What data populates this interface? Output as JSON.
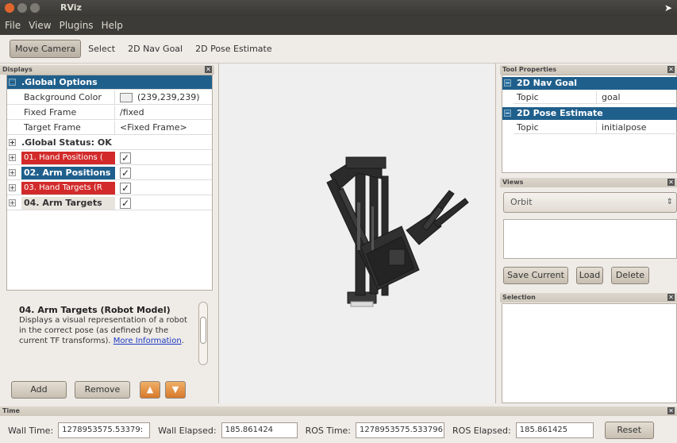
{
  "window": {
    "title": "RViz"
  },
  "menu": [
    "File",
    "View",
    "Plugins",
    "Help"
  ],
  "toolbar": {
    "tools": [
      "Move Camera",
      "Select",
      "2D Nav Goal",
      "2D Pose Estimate"
    ],
    "active": "Move Camera"
  },
  "displays": {
    "title": "Displays",
    "global_options": {
      "label": ".Global Options",
      "props": [
        {
          "name": "Background Color",
          "value": "(239,239,239)",
          "swatch": "#efefef"
        },
        {
          "name": "Fixed Frame",
          "value": "/fixed"
        },
        {
          "name": "Target Frame",
          "value": "<Fixed Frame>"
        }
      ]
    },
    "global_status": ".Global Status: OK",
    "items": [
      {
        "label": "01. Hand Positions (",
        "status": "error",
        "checked": "✓"
      },
      {
        "label": "02. Arm Positions",
        "status": "ok",
        "checked": "✓"
      },
      {
        "label": "03. Hand Targets (R",
        "status": "error",
        "checked": "✓"
      },
      {
        "label": "04. Arm Targets",
        "status": "warn",
        "checked": "✓"
      }
    ]
  },
  "description": {
    "title": "04. Arm Targets (Robot Model)",
    "text": "Displays a visual representation of a robot in the correct pose (as defined by the current TF transforms).",
    "link": "More Information",
    "link_tail": "."
  },
  "display_buttons": {
    "add": "Add",
    "remove": "Remove"
  },
  "tool_properties": {
    "title": "Tool Properties",
    "groups": [
      {
        "label": "2D Nav Goal",
        "key": "Topic",
        "value": "goal"
      },
      {
        "label": "2D Pose Estimate",
        "key": "Topic",
        "value": "initialpose"
      }
    ]
  },
  "views": {
    "title": "Views",
    "selected": "Orbit",
    "save": "Save Current",
    "load": "Load",
    "delete": "Delete"
  },
  "selection": {
    "title": "Selection"
  },
  "time": {
    "title": "Time",
    "wall_time_label": "Wall Time:",
    "wall_time": "1278953575.53379:",
    "wall_elapsed_label": "Wall Elapsed:",
    "wall_elapsed": "185.861424",
    "ros_time_label": "ROS Time:",
    "ros_time": "1278953575.533796",
    "ros_elapsed_label": "ROS Elapsed:",
    "ros_elapsed": "185.861425",
    "reset": "Reset"
  }
}
